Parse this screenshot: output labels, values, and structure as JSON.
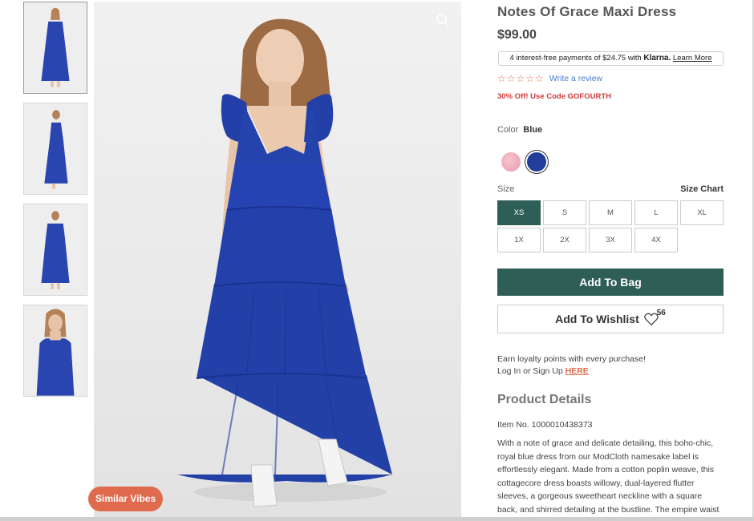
{
  "product": {
    "title": "Notes Of Grace Maxi Dress",
    "price": "$99.00",
    "klarna": {
      "prefix": "4 interest-free payments of $24.75 with",
      "brand": "Klarna.",
      "link": "Learn More"
    },
    "stars": "☆☆☆☆☆",
    "review_link": "Write a review",
    "promo": "30% Off! Use Code GOFOURTH",
    "color_label": "Color",
    "color_value": "Blue",
    "size_label": "Size",
    "size_chart": "Size Chart",
    "sizes": [
      "XS",
      "S",
      "M",
      "L",
      "XL",
      "1X",
      "2X",
      "3X",
      "4X"
    ],
    "add_to_bag": "Add To Bag",
    "add_to_wishlist": "Add To Wishlist",
    "wishlist_count": "56",
    "loyalty_line1": "Earn loyalty points with every purchase!",
    "loyalty_line2": "Log In or Sign Up",
    "loyalty_link": "HERE",
    "details_title": "Product Details",
    "item_no": "Item No. 1000010438373",
    "description": "With a note of grace and delicate detailing, this boho-chic, royal blue dress from our ModCloth namesake label is effortlessly elegant. Made from a cotton poplin weave, this cottagecore dress boasts willowy, dual-layered flutter sleeves, a gorgeous sweetheart neckline with a square back, and shirred detailing at the bustline. The empire waist of this"
  },
  "gallery": {
    "similar_vibes": "Similar Vibes"
  },
  "colors": {
    "accent_green": "#2e5e56",
    "accent_orange": "#e06a4e",
    "dress_blue": "#233e9a",
    "promo_red": "#d13a3a"
  }
}
